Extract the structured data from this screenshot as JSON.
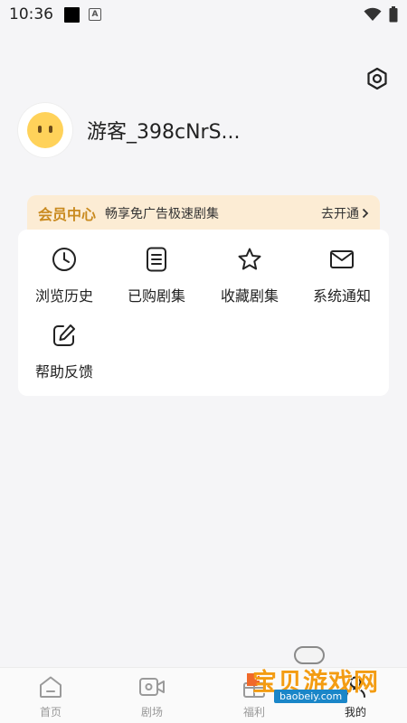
{
  "status_bar": {
    "time": "10:36"
  },
  "profile": {
    "username": "游客_398cNrS..."
  },
  "vip": {
    "title": "会员中心",
    "subtitle": "畅享免广告极速剧集",
    "action": "去开通"
  },
  "menu": {
    "history": "浏览历史",
    "purchased": "已购剧集",
    "favorites": "收藏剧集",
    "notifications": "系统通知",
    "feedback": "帮助反馈"
  },
  "tabs": {
    "home": "首页",
    "theater": "剧场",
    "welfare": "福利",
    "mine": "我的"
  },
  "watermark": {
    "text": "宝贝游戏网",
    "url": "baobeiy.com"
  },
  "colors": {
    "vip_accent": "#c98a1f",
    "vip_bg": "#fcecd4",
    "watermark_orange": "#f39c12",
    "watermark_blue": "#1a86c8"
  }
}
